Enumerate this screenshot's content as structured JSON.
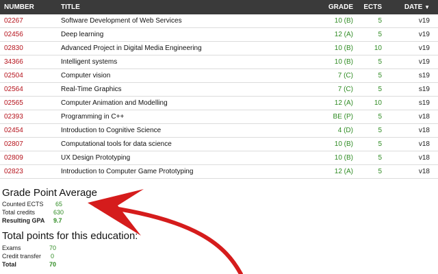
{
  "header": {
    "number": "NUMBER",
    "title": "TITLE",
    "grade": "GRADE",
    "ects": "ECTS",
    "date": "DATE",
    "sort_indicator": "▼"
  },
  "courses": [
    {
      "number": "02267",
      "title": "Software Development of Web Services",
      "grade": "10 (B)",
      "ects": "5",
      "date": "v19"
    },
    {
      "number": "02456",
      "title": "Deep learning",
      "grade": "12 (A)",
      "ects": "5",
      "date": "v19"
    },
    {
      "number": "02830",
      "title": "Advanced Project in Digital Media Engineering",
      "grade": "10 (B)",
      "ects": "10",
      "date": "v19"
    },
    {
      "number": "34366",
      "title": "Intelligent systems",
      "grade": "10 (B)",
      "ects": "5",
      "date": "v19"
    },
    {
      "number": "02504",
      "title": "Computer vision",
      "grade": "7 (C)",
      "ects": "5",
      "date": "s19"
    },
    {
      "number": "02564",
      "title": "Real-Time Graphics",
      "grade": "7 (C)",
      "ects": "5",
      "date": "s19"
    },
    {
      "number": "02565",
      "title": "Computer Animation and Modelling",
      "grade": "12 (A)",
      "ects": "10",
      "date": "s19"
    },
    {
      "number": "02393",
      "title": "Programming in C++",
      "grade": "BE (P)",
      "ects": "5",
      "date": "v18"
    },
    {
      "number": "02454",
      "title": "Introduction to Cognitive Science",
      "grade": "4 (D)",
      "ects": "5",
      "date": "v18"
    },
    {
      "number": "02807",
      "title": "Computational tools for data science",
      "grade": "10 (B)",
      "ects": "5",
      "date": "v18"
    },
    {
      "number": "02809",
      "title": "UX Design Prototyping",
      "grade": "10 (B)",
      "ects": "5",
      "date": "v18"
    },
    {
      "number": "02823",
      "title": "Introduction to Computer Game Prototyping",
      "grade": "12 (A)",
      "ects": "5",
      "date": "v18"
    }
  ],
  "gpa": {
    "title": "Grade Point Average",
    "counted_ects_label": "Counted ECTS",
    "counted_ects": "65",
    "total_credits_label": "Total credits",
    "total_credits": "630",
    "resulting_gpa_label": "Resulting GPA",
    "resulting_gpa": "9.7"
  },
  "points": {
    "title": "Total points for this education:",
    "exams_label": "Exams",
    "exams": "70",
    "transfer_label": "Credit transfer",
    "transfer": "0",
    "total_label": "Total",
    "total": "70"
  },
  "colors": {
    "header_bg": "#3a3a3a",
    "course_number": "#b5121b",
    "value_green": "#2e8b22",
    "annotation_arrow": "#d51c1c"
  }
}
